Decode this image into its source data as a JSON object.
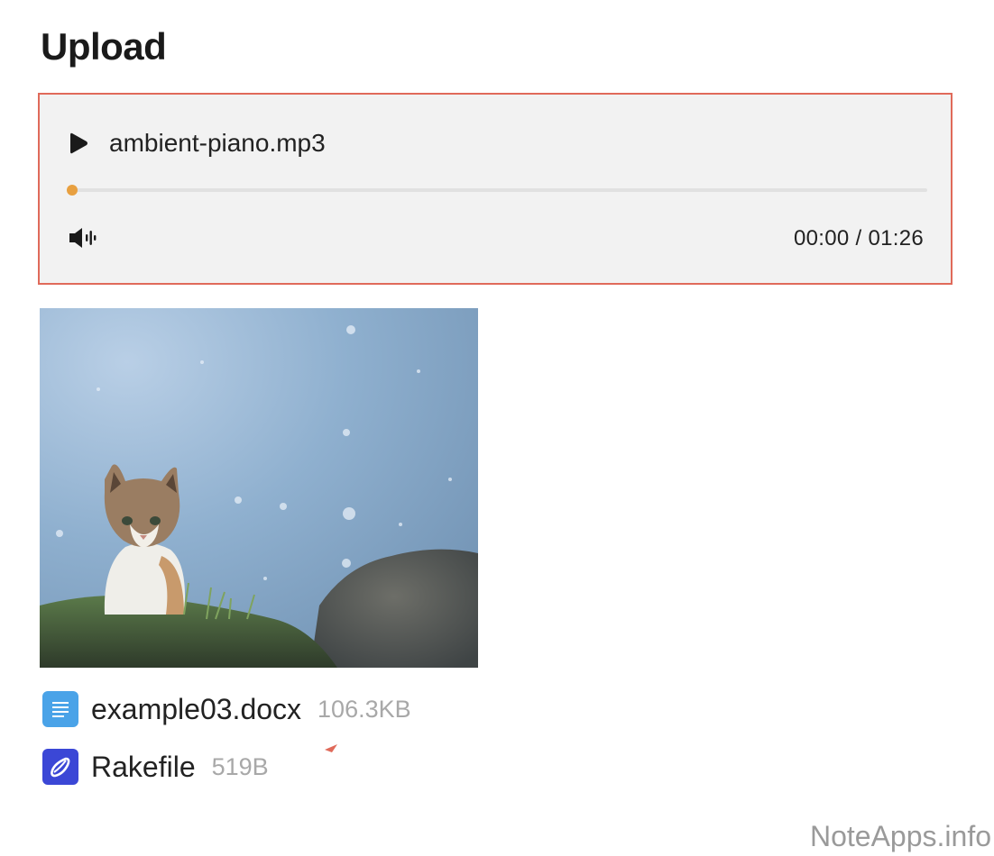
{
  "page": {
    "title": "Upload"
  },
  "audio": {
    "file_name": "ambient-piano.mp3",
    "current_time": "00:00",
    "duration": "01:26",
    "time_separator": " / ",
    "progress_fraction": 0,
    "accent_color": "#e8a040",
    "border_color": "#e06a5a",
    "play_icon": "play-icon",
    "volume_icon": "volume-icon"
  },
  "image": {
    "description_icon": "image-thumbnail"
  },
  "attachments": [
    {
      "name": "example03.docx",
      "size": "106.3KB",
      "icon": "document-icon",
      "icon_color": "#4aa3e8"
    },
    {
      "name": "Rakefile",
      "size": "519B",
      "icon": "rake-file-icon",
      "icon_color": "#3b47d6"
    }
  ],
  "watermark": "NoteApps.info"
}
